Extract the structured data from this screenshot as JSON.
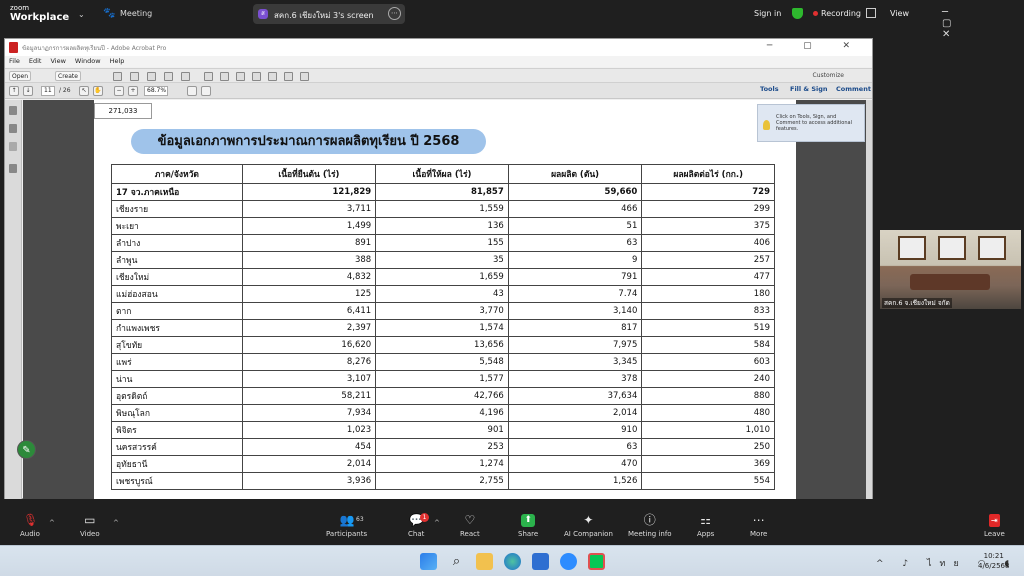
{
  "zoom": {
    "logo_line1": "zoom",
    "logo_line2": "Workplace",
    "meeting_label": "Meeting",
    "share_pill": {
      "badge": "ส",
      "text": "สคก.6 เชียงใหม่ 3's screen"
    },
    "sign_in": "Sign in",
    "recording": "Recording",
    "view": "View",
    "window_controls": "─ ▢ ✕"
  },
  "acrobat": {
    "window_title": "ข้อมูลนาฏกรการผลผลิตทุเรียนปี - Adobe Acrobat Pro",
    "title_controls": "─ ▢ ✕",
    "menu": [
      "File",
      "Edit",
      "View",
      "Window",
      "Help"
    ],
    "toolbar": {
      "open": "Open",
      "create": "Create",
      "customize": "Customize"
    },
    "page_current": "11",
    "page_total": "/ 26",
    "zoom_level": "68.7%",
    "tabs": {
      "tools": "Tools",
      "fill_sign": "Fill & Sign",
      "comment": "Comment"
    },
    "tooltip": "Click on Tools, Sign, and Comment to access additional features."
  },
  "document": {
    "top_value": "271,033",
    "heading": "ข้อมูลเอกภาพการประมาณการผลผลิตทุเรียน ปี 2568",
    "columns": [
      "ภาค/จังหวัด",
      "เนื้อที่ยืนต้น (ไร่)",
      "เนื้อที่ให้ผล (ไร่)",
      "ผลผลิต (ตัน)",
      "ผลผลิตต่อไร่ (กก.)"
    ],
    "summary_row": [
      "17 จว.ภาคเหนือ",
      "121,829",
      "81,857",
      "59,660",
      "729"
    ],
    "rows": [
      [
        "เชียงราย",
        "3,711",
        "1,559",
        "466",
        "299"
      ],
      [
        "พะเยา",
        "1,499",
        "136",
        "51",
        "375"
      ],
      [
        "ลำปาง",
        "891",
        "155",
        "63",
        "406"
      ],
      [
        "ลำพูน",
        "388",
        "35",
        "9",
        "257"
      ],
      [
        "เชียงใหม่",
        "4,832",
        "1,659",
        "791",
        "477"
      ],
      [
        "แม่ฮ่องสอน",
        "125",
        "43",
        "7.74",
        "180"
      ],
      [
        "ตาก",
        "6,411",
        "3,770",
        "3,140",
        "833"
      ],
      [
        "กำแพงเพชร",
        "2,397",
        "1,574",
        "817",
        "519"
      ],
      [
        "สุโขทัย",
        "16,620",
        "13,656",
        "7,975",
        "584"
      ],
      [
        "แพร่",
        "8,276",
        "5,548",
        "3,345",
        "603"
      ],
      [
        "น่าน",
        "3,107",
        "1,577",
        "378",
        "240"
      ],
      [
        "อุตรดิตถ์",
        "58,211",
        "42,766",
        "37,634",
        "880"
      ],
      [
        "พิษณุโลก",
        "7,934",
        "4,196",
        "2,014",
        "480"
      ],
      [
        "พิจิตร",
        "1,023",
        "901",
        "910",
        "1,010"
      ],
      [
        "นครสวรรค์",
        "454",
        "253",
        "63",
        "250"
      ],
      [
        "อุทัยธานี",
        "2,014",
        "1,274",
        "470",
        "369"
      ],
      [
        "เพชรบูรณ์",
        "3,936",
        "2,755",
        "1,526",
        "554"
      ]
    ]
  },
  "participant": {
    "caption": "สคก.6 จ.เชียงใหม่ จกัด"
  },
  "bottom_toolbar": {
    "audio": "Audio",
    "video": "Video",
    "participants_count": "63",
    "participants": "Participants",
    "chat": "Chat",
    "chat_badge": "1",
    "react": "React",
    "share": "Share",
    "ai_companion": "AI Companion",
    "meeting_info": "Meeting info",
    "apps": "Apps",
    "more": "More",
    "leave": "Leave"
  },
  "taskbar": {
    "tray": "^ ♪ ไทย ◠ ◖",
    "time": "10:21",
    "date": "4/6/2568"
  },
  "colors": {
    "heading_pill": "#9fc3ea",
    "share_green": "#2bb24c",
    "leave_red": "#e02828",
    "record_red": "#e03030"
  }
}
